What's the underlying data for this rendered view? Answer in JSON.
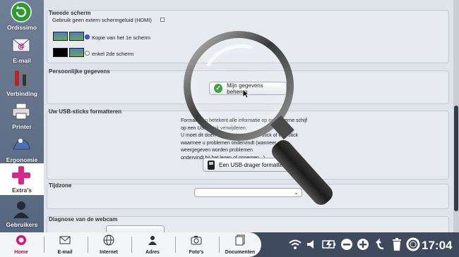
{
  "sidebar": {
    "items": [
      {
        "label": "Ordissimo"
      },
      {
        "label": "E-mail"
      },
      {
        "label": "Verbinding"
      },
      {
        "label": "Printer"
      },
      {
        "label": "Ergonomie"
      },
      {
        "label": "Extra's"
      },
      {
        "label": "Gebruikers"
      }
    ]
  },
  "settings": {
    "second_screen": {
      "title": "Tweede scherm",
      "no_external_sound": "Gebruik geen extern schermgeluid (HDMI)",
      "option_copy": "Kopie van het 1e scherm",
      "option_only_second": "enkel 2de scherm"
    },
    "personal": {
      "title": "Persoonlijke gegevens",
      "button": "Mijn gegevens beheren"
    },
    "usb": {
      "title": "Uw USB-sticks formatteren",
      "description": "Formatteren betekent alle informatie op een externe schijf\nop een USB-stick verwijderen.\nU moet dit doen bij een nieuwe USB-stick of een stick\nwaarmee u problemen ondervindt (wanneer\nweergegeven worden problemen\nondervindt bij het lezen of opnemen...)",
      "button": "Een USB-drager formatteren"
    },
    "timezone": {
      "title": "Tijdzone",
      "selected": ""
    },
    "webcam": {
      "title": "Diagnose van de webcam"
    }
  },
  "taskbar": {
    "items": [
      {
        "label": "Home"
      },
      {
        "label": "E-mail"
      },
      {
        "label": "Internet"
      },
      {
        "label": "Adres"
      },
      {
        "label": "Foto's"
      },
      {
        "label": "Documenten"
      }
    ],
    "clock": "17:04"
  },
  "colors": {
    "sidebar": "#5f6f87",
    "taskbar": "#3f4a5e",
    "accent": "#c8106a",
    "radio_selected": "#3a5ad8"
  }
}
